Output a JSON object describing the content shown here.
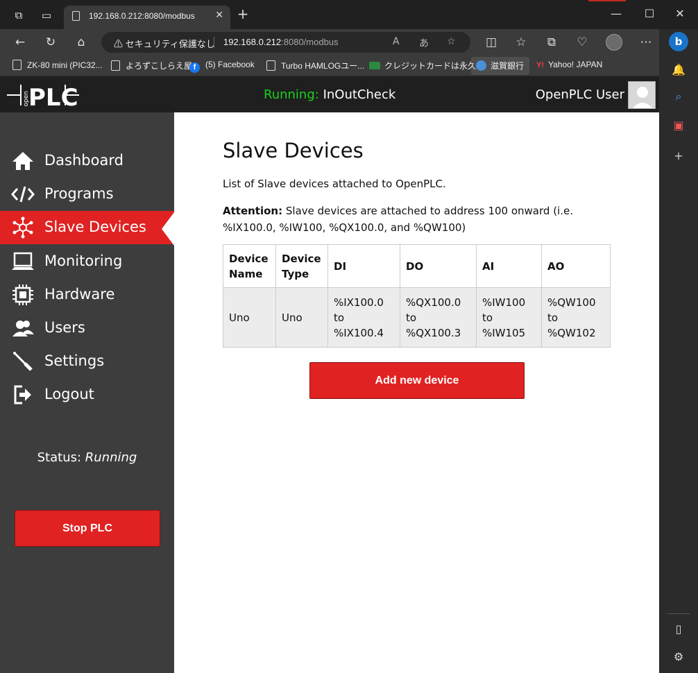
{
  "browser": {
    "tab_title": "192.168.0.212:8080/modbus",
    "security_warning": "セキュリティ保護なし",
    "url_host": "192.168.0.212",
    "url_path": ":8080/modbus",
    "bookmarks": [
      {
        "label": "ZK-80 mini (PIC32...",
        "icon": "page-icon"
      },
      {
        "label": "よろずこしらえ屋",
        "icon": "page-icon"
      },
      {
        "label": "(5) Facebook",
        "icon": "facebook-icon"
      },
      {
        "label": "Turbo HAMLOGユー...",
        "icon": "page-icon"
      },
      {
        "label": "クレジットカードは永久...",
        "icon": "card-icon"
      },
      {
        "label": "滋賀銀行",
        "icon": "globe-icon"
      },
      {
        "label": "Yahoo! JAPAN",
        "icon": "yahoo-icon"
      }
    ]
  },
  "header": {
    "logo_text": "PLC",
    "logo_small": "open",
    "running_label": "Running:",
    "running_program": "InOutCheck",
    "user_name": "OpenPLC User"
  },
  "sidebar": {
    "items": [
      {
        "label": "Dashboard",
        "icon": "home-icon"
      },
      {
        "label": "Programs",
        "icon": "code-icon"
      },
      {
        "label": "Slave Devices",
        "icon": "network-icon"
      },
      {
        "label": "Monitoring",
        "icon": "monitor-icon"
      },
      {
        "label": "Hardware",
        "icon": "chip-icon"
      },
      {
        "label": "Users",
        "icon": "users-icon"
      },
      {
        "label": "Settings",
        "icon": "wrench-icon"
      },
      {
        "label": "Logout",
        "icon": "logout-icon"
      }
    ],
    "status_label": "Status:",
    "status_value": "Running",
    "stop_button": "Stop PLC"
  },
  "main": {
    "title": "Slave Devices",
    "intro": "List of Slave devices attached to OpenPLC.",
    "attention_label": "Attention:",
    "attention_text": " Slave devices are attached to address 100 onward (i.e. %IX100.0, %IW100, %QX100.0, and %QW100)",
    "table": {
      "headers": [
        [
          "Device",
          "Name"
        ],
        [
          "Device",
          "Type"
        ],
        [
          "DI"
        ],
        [
          "DO"
        ],
        [
          "AI"
        ],
        [
          "AO"
        ]
      ],
      "rows": [
        [
          [
            "Uno"
          ],
          [
            "Uno"
          ],
          [
            "%IX100.0",
            "to",
            "%IX100.4"
          ],
          [
            "%QX100.0",
            "to",
            "%QX100.3"
          ],
          [
            "%IW100",
            "to",
            "%IW105"
          ],
          [
            "%QW100",
            "to",
            "%QW102"
          ]
        ]
      ]
    },
    "add_button": "Add new device"
  }
}
